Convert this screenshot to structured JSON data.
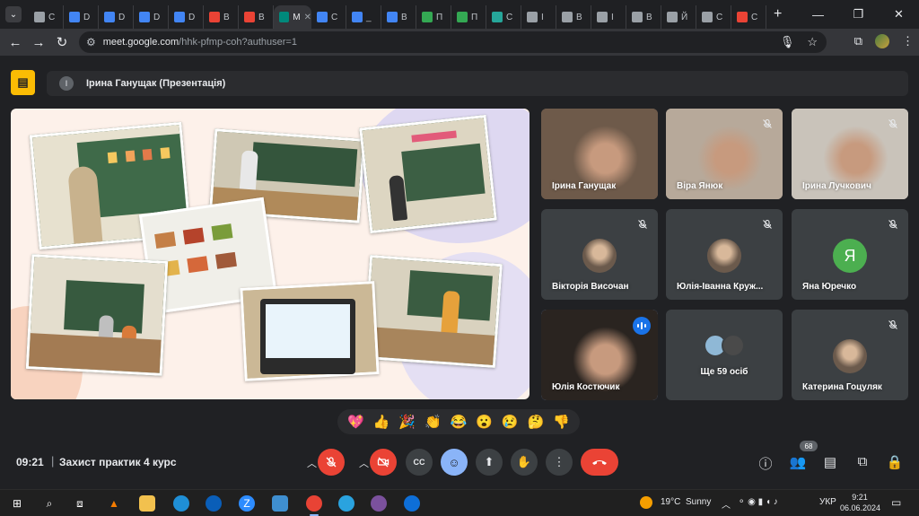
{
  "browser": {
    "tabs": [
      {
        "label": "C",
        "color": "#9aa0a6"
      },
      {
        "label": "D",
        "color": "#4285f4"
      },
      {
        "label": "D",
        "color": "#4285f4"
      },
      {
        "label": "D",
        "color": "#4285f4"
      },
      {
        "label": "D",
        "color": "#4285f4"
      },
      {
        "label": "B",
        "color": "#ea4335"
      },
      {
        "label": "B",
        "color": "#ea4335"
      },
      {
        "label": "M",
        "color": "#00897b",
        "active": true
      },
      {
        "label": "C",
        "color": "#4285f4"
      },
      {
        "label": "_",
        "color": "#4285f4"
      },
      {
        "label": "B",
        "color": "#4285f4"
      },
      {
        "label": "П",
        "color": "#34a853"
      },
      {
        "label": "П",
        "color": "#34a853"
      },
      {
        "label": "C",
        "color": "#26a69a"
      },
      {
        "label": "I",
        "color": "#9aa0a6"
      },
      {
        "label": "B",
        "color": "#9aa0a6"
      },
      {
        "label": "I",
        "color": "#9aa0a6"
      },
      {
        "label": "B",
        "color": "#9aa0a6"
      },
      {
        "label": "Й",
        "color": "#9aa0a6"
      },
      {
        "label": "C",
        "color": "#9aa0a6"
      },
      {
        "label": "C",
        "color": "#ea4335"
      }
    ],
    "url_host": "meet.google.com",
    "url_path": "/hhk-pfmp-coh?authuser=1"
  },
  "presentation": {
    "avatar_letter": "І",
    "label": "Ірина Ганущак (Презентація)"
  },
  "participants": [
    {
      "name": "Ірина Ганущак",
      "muted": false,
      "speaking": false,
      "kind": "video",
      "bg": "#6e5a4a"
    },
    {
      "name": "Віра Янюк",
      "muted": true,
      "speaking": false,
      "kind": "video",
      "bg": "#b7a99a"
    },
    {
      "name": "Ірина Лучкович",
      "muted": true,
      "speaking": false,
      "kind": "video",
      "bg": "#c9c3ba"
    },
    {
      "name": "Вікторія Височан",
      "muted": true,
      "speaking": false,
      "kind": "photo",
      "bg": "#3c4043"
    },
    {
      "name": "Юлія-Іванна Круж...",
      "muted": true,
      "speaking": false,
      "kind": "photo",
      "bg": "#3c4043"
    },
    {
      "name": "Яна Юречко",
      "muted": true,
      "speaking": false,
      "kind": "letter",
      "letter": "Я",
      "letter_bg": "#4caf50",
      "bg": "#3c4043"
    },
    {
      "name": "Юлія Костючик",
      "muted": false,
      "speaking": true,
      "kind": "video",
      "bg": "#2a2420"
    },
    {
      "name": "Ще 59 осіб",
      "muted": false,
      "speaking": false,
      "kind": "more",
      "bg": "#3c4043"
    },
    {
      "name": "Катерина Гоцуляк",
      "muted": true,
      "speaking": false,
      "kind": "photo",
      "bg": "#3c4043"
    }
  ],
  "reactions": [
    "💖",
    "👍",
    "🎉",
    "👏",
    "😂",
    "😮",
    "😢",
    "🤔",
    "👎"
  ],
  "meeting": {
    "time": "09:21",
    "separator": "|",
    "name": "Захист практик 4 курс",
    "participant_count": "68"
  },
  "taskbar": {
    "temperature": "19°C",
    "weather": "Sunny",
    "language": "УКР",
    "time": "9:21",
    "date": "06.06.2024"
  }
}
